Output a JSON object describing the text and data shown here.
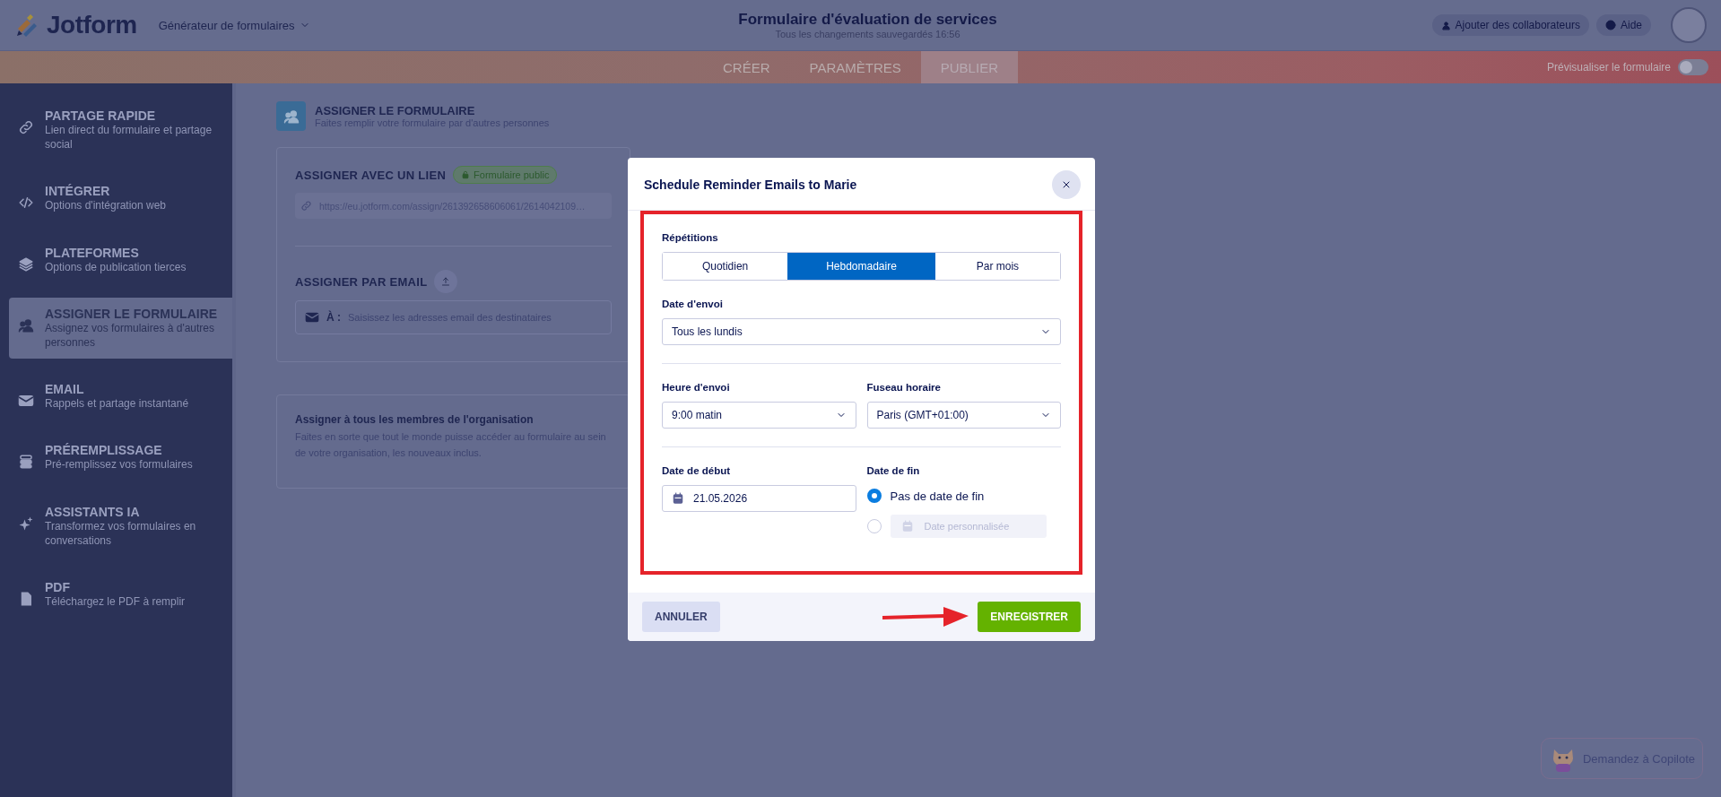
{
  "header": {
    "logo_text": "Jotform",
    "builder_menu": "Générateur de formulaires",
    "title": "Formulaire d'évaluation de services",
    "save_status": "Tous les changements sauvegardés 16:56",
    "collaborators_button": "Ajouter des collaborateurs",
    "help_button": "Aide"
  },
  "nav": {
    "tabs": [
      {
        "label": "CRÉER",
        "selected": false
      },
      {
        "label": "PARAMÈTRES",
        "selected": false
      },
      {
        "label": "PUBLIER",
        "selected": true
      }
    ],
    "preview_toggle": {
      "label": "Prévisualiser le formulaire",
      "on": false
    }
  },
  "sidebar": {
    "items": [
      {
        "title": "PARTAGE RAPIDE",
        "subtitle": "Lien direct du formulaire et partage social",
        "selected": false
      },
      {
        "title": "INTÉGRER",
        "subtitle": "Options d'intégration web",
        "selected": false
      },
      {
        "title": "PLATEFORMES",
        "subtitle": "Options de publication tierces",
        "selected": false
      },
      {
        "title": "ASSIGNER LE FORMULAIRE",
        "subtitle": "Assignez vos formulaires à d'autres personnes",
        "selected": true
      },
      {
        "title": "EMAIL",
        "subtitle": "Rappels et partage instantané",
        "selected": false
      },
      {
        "title": "PRÉREMPLISSAGE",
        "subtitle": "Pré-remplissez vos formulaires",
        "selected": false
      },
      {
        "title": "ASSISTANTS IA",
        "subtitle": "Transformez vos formulaires en conversations",
        "selected": false
      },
      {
        "title": "PDF",
        "subtitle": "Téléchargez le PDF à remplir",
        "selected": false
      }
    ]
  },
  "main": {
    "title": "ASSIGNER LE FORMULAIRE",
    "subtitle": "Faites remplir votre formulaire par d'autres personnes",
    "link_section": {
      "heading": "ASSIGNER AVEC UN LIEN",
      "badge": "Formulaire public",
      "url": "https://eu.jotform.com/assign/261392658606061/2614042109…"
    },
    "email_section": {
      "heading": "ASSIGNER PAR EMAIL",
      "to_label": "À :",
      "placeholder": "Saisissez les adresses email des destinataires"
    },
    "org_card": {
      "title": "Assigner à tous les membres de l'organisation",
      "description": "Faites en sorte que tout le monde puisse accéder au formulaire au sein de votre organisation, les nouveaux inclus."
    }
  },
  "modal": {
    "title": "Schedule Reminder Emails to Marie",
    "repetitions": {
      "label": "Répétitions",
      "options": [
        {
          "label": "Quotidien",
          "selected": false
        },
        {
          "label": "Hebdomadaire",
          "selected": true
        },
        {
          "label": "Par mois",
          "selected": false
        }
      ]
    },
    "send_date": {
      "label": "Date d'envoi",
      "value": "Tous les lundis"
    },
    "send_time": {
      "label": "Heure d'envoi",
      "value": "9:00 matin"
    },
    "timezone": {
      "label": "Fuseau horaire",
      "value": "Paris (GMT+01:00)"
    },
    "start_date": {
      "label": "Date de début",
      "value": "21.05.2026"
    },
    "end_date": {
      "label": "Date de fin",
      "options": [
        {
          "kind": "text",
          "label": "Pas de date de fin",
          "selected": true
        },
        {
          "kind": "date",
          "placeholder": "Date personnalisée",
          "selected": false
        }
      ]
    },
    "cancel_button": "ANNULER",
    "save_button": "ENREGISTRER"
  },
  "copilot": {
    "label": "Demandez à Copilote"
  }
}
